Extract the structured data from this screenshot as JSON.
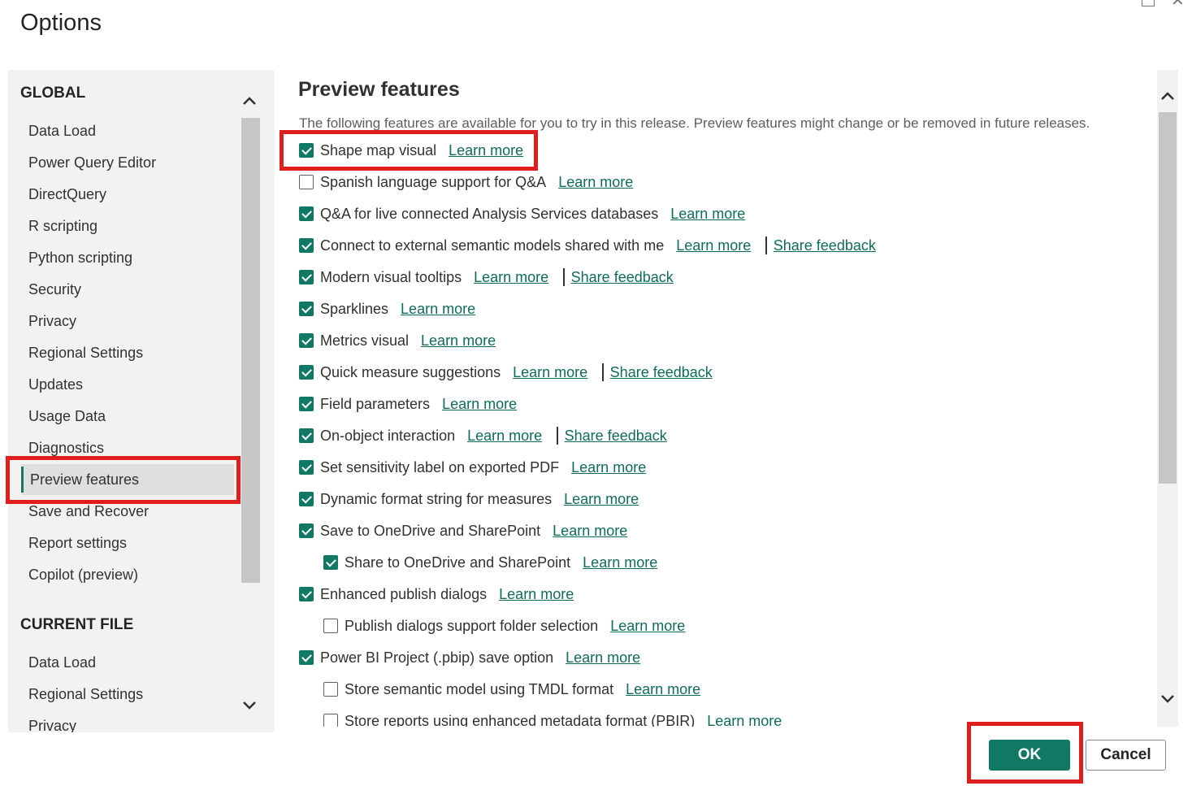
{
  "window": {
    "title": "Options"
  },
  "nav": {
    "global_header": "GLOBAL",
    "global_items": [
      "Data Load",
      "Power Query Editor",
      "DirectQuery",
      "R scripting",
      "Python scripting",
      "Security",
      "Privacy",
      "Regional Settings",
      "Updates",
      "Usage Data",
      "Diagnostics",
      "Preview features",
      "Save and Recover",
      "Report settings",
      "Copilot (preview)"
    ],
    "selected": "Preview features",
    "current_file_header": "CURRENT FILE",
    "current_file_items": [
      "Data Load",
      "Regional Settings",
      "Privacy"
    ]
  },
  "content": {
    "title": "Preview features",
    "description": "The following features are available for you to try in this release. Preview features might change or be removed in future releases.",
    "learn_more_label": "Learn more",
    "share_feedback_label": "Share feedback",
    "features": [
      {
        "label": "Shape map visual",
        "checked": true,
        "indent": false,
        "feedback": false
      },
      {
        "label": "Spanish language support for Q&A",
        "checked": false,
        "indent": false,
        "feedback": false
      },
      {
        "label": "Q&A for live connected Analysis Services databases",
        "checked": true,
        "indent": false,
        "feedback": false
      },
      {
        "label": "Connect to external semantic models shared with me",
        "checked": true,
        "indent": false,
        "feedback": true
      },
      {
        "label": "Modern visual tooltips",
        "checked": true,
        "indent": false,
        "feedback": true
      },
      {
        "label": "Sparklines",
        "checked": true,
        "indent": false,
        "feedback": false
      },
      {
        "label": "Metrics visual",
        "checked": true,
        "indent": false,
        "feedback": false
      },
      {
        "label": "Quick measure suggestions",
        "checked": true,
        "indent": false,
        "feedback": true
      },
      {
        "label": "Field parameters",
        "checked": true,
        "indent": false,
        "feedback": false
      },
      {
        "label": "On-object interaction",
        "checked": true,
        "indent": false,
        "feedback": true
      },
      {
        "label": "Set sensitivity label on exported PDF",
        "checked": true,
        "indent": false,
        "feedback": false
      },
      {
        "label": "Dynamic format string for measures",
        "checked": true,
        "indent": false,
        "feedback": false
      },
      {
        "label": "Save to OneDrive and SharePoint",
        "checked": true,
        "indent": false,
        "feedback": false
      },
      {
        "label": "Share to OneDrive and SharePoint",
        "checked": true,
        "indent": true,
        "feedback": false
      },
      {
        "label": "Enhanced publish dialogs",
        "checked": true,
        "indent": false,
        "feedback": false
      },
      {
        "label": "Publish dialogs support folder selection",
        "checked": false,
        "indent": true,
        "feedback": false
      },
      {
        "label": "Power BI Project (.pbip) save option",
        "checked": true,
        "indent": false,
        "feedback": false
      },
      {
        "label": "Store semantic model using TMDL format",
        "checked": false,
        "indent": true,
        "feedback": false
      },
      {
        "label": "Store reports using enhanced metadata format (PBIR)",
        "checked": false,
        "indent": true,
        "feedback": false
      }
    ]
  },
  "buttons": {
    "ok": "OK",
    "cancel": "Cancel"
  },
  "colors": {
    "accent": "#117865",
    "highlight": "#e01e1e",
    "link": "#0f6b5c"
  }
}
